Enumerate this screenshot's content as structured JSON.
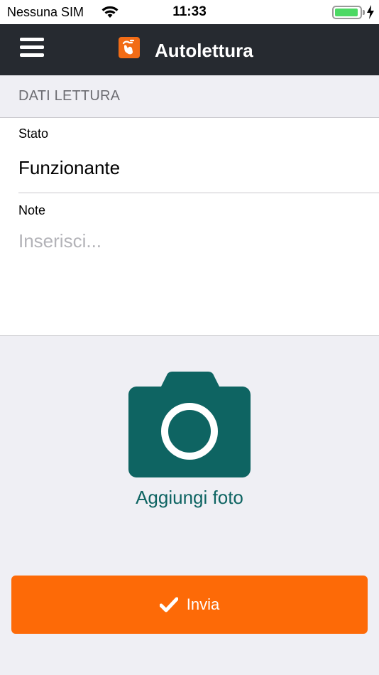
{
  "status_bar": {
    "carrier": "Nessuna SIM",
    "time": "11:33",
    "battery_level": 1.0
  },
  "nav": {
    "title": "Autolettura",
    "menu_icon": "hamburger-menu-icon",
    "logo_icon": "app-logo-icon",
    "bar_color": "#262a30",
    "logo_color": "#f26c16"
  },
  "section": {
    "title": "DATI LETTURA"
  },
  "form": {
    "stato_label": "Stato",
    "stato_value": "Funzionante",
    "note_label": "Note",
    "note_placeholder": "Inserisci...",
    "note_value": ""
  },
  "photo": {
    "label": "Aggiungi foto",
    "icon": "camera-icon",
    "color": "#0e6462"
  },
  "submit": {
    "label": "Invia",
    "icon": "checkmark-icon",
    "color": "#fd6a07"
  }
}
